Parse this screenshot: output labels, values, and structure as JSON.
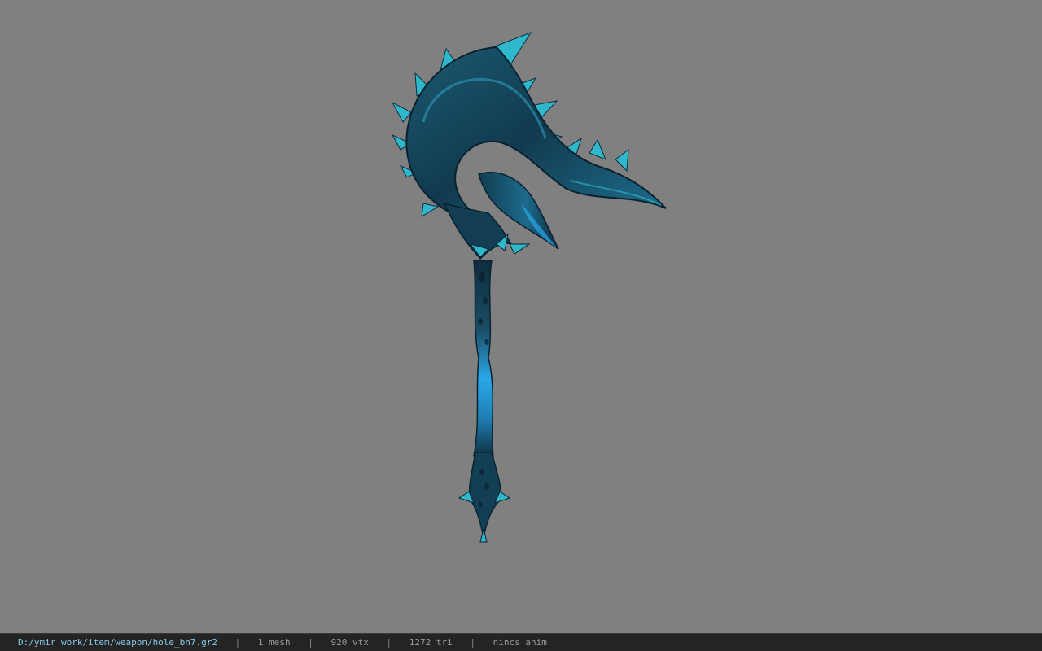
{
  "viewport": {
    "background": "#808080",
    "model": {
      "icon": "blue-scythe-weapon-model",
      "colors": {
        "dark": "#0f2c3c",
        "mid": "#1f6e8e",
        "bright": "#2aa8e8",
        "spike": "#2fb8cc"
      }
    }
  },
  "status_bar": {
    "file_path": "D:/ymir work/item/weapon/hole_bn7.gr2",
    "separator": "|",
    "mesh": "1 mesh",
    "vertices": "920 vtx",
    "triangles": "1272 tri",
    "animation": "nincs anim"
  }
}
